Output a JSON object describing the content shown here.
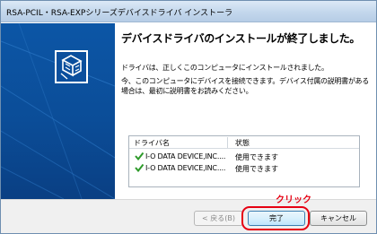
{
  "window": {
    "title": "RSA-PCIL・RSA-EXPシリーズデバイスドライバ インストーラ"
  },
  "content": {
    "heading": "デバイスドライバのインストールが終了しました。",
    "message_installed": "ドライバは、正しくこのコンピュータにインストールされました。",
    "message_connect": "今、このコンピュータにデバイスを接続できます。デバイス付属の説明書がある場合は、最初に説明書をお読みください。"
  },
  "driver_list": {
    "columns": [
      "ドライバ名",
      "状態"
    ],
    "rows": [
      {
        "name": "I-O DATA DEVICE,INC....",
        "status": "使用できます",
        "icon": "green-check-icon"
      },
      {
        "name": "I-O DATA DEVICE,INC....",
        "status": "使用できます",
        "icon": "green-check-icon"
      }
    ]
  },
  "annotation": {
    "callout": "クリック",
    "color": "#e60012"
  },
  "buttons": {
    "back": "< 戻る(B)",
    "finish": "完了",
    "cancel": "キャンセル"
  },
  "colors": {
    "side_panel": "#0b4f9d",
    "check": "#2e9a2a"
  }
}
